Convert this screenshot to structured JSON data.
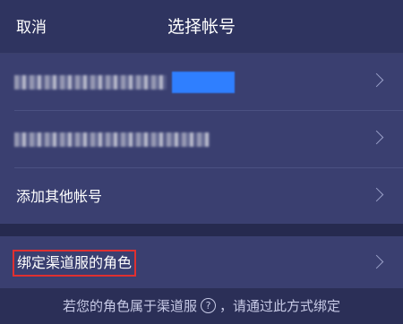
{
  "nav": {
    "cancel_label": "取消",
    "title": "选择帐号"
  },
  "accounts": {
    "items": [
      {
        "label": "",
        "obscured": true,
        "highlight_color": "#2f7fff"
      },
      {
        "label": "",
        "obscured": true
      },
      {
        "label": "添加其他帐号",
        "obscured": false
      }
    ]
  },
  "bind": {
    "label": "绑定渠道服的角色",
    "highlight_border_color": "#e03030"
  },
  "footer": {
    "text_before": "若您的角色属于渠道服",
    "help_icon": "?",
    "text_after": "，请通过此方式绑定"
  },
  "icons": {
    "row_arrow": "chevron-right-icon",
    "help": "question-circle-icon"
  },
  "colors": {
    "background": "#2b2f57",
    "row_background": "#3a3f70",
    "accent": "#2f7fff",
    "highlight_border": "#e03030"
  }
}
